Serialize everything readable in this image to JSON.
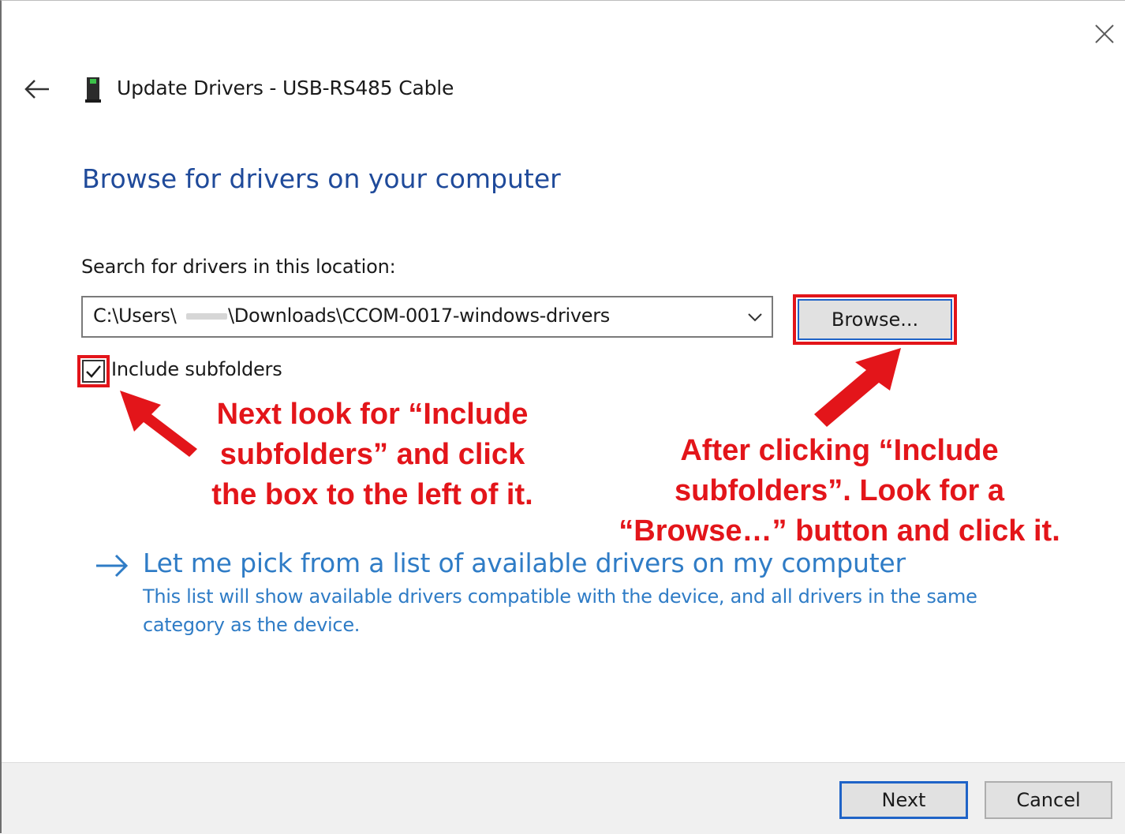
{
  "window": {
    "title": "Update Drivers - USB-RS485 Cable",
    "icons": {
      "close": "close-icon",
      "back": "back-arrow-icon",
      "device": "usb-device-icon"
    }
  },
  "page": {
    "heading": "Browse for drivers on your computer",
    "search_label": "Search for drivers in this location:",
    "path_value_start": "C:\\Users\\",
    "path_value_end": "\\Downloads\\CCOM-0017-windows-drivers",
    "browse_label": "Browse...",
    "include_subfolders_label": "Include subfolders",
    "include_subfolders_checked": true
  },
  "annotations": {
    "left": [
      "Next look for “Include",
      "subfolders” and click",
      "the box to the left of it."
    ],
    "right": [
      "After clicking “Include",
      "subfolders”. Look for a",
      "“Browse…” button and click it."
    ],
    "highlight_color": "#e3151a"
  },
  "pick_option": {
    "title": "Let me pick from a list of available drivers on my computer",
    "description": "This list will show available drivers compatible with the device, and all drivers in the same category as the device.",
    "icon": "right-arrow-icon"
  },
  "footer": {
    "next_label": "Next",
    "cancel_label": "Cancel"
  },
  "colors": {
    "heading": "#1f4a9a",
    "link": "#2f7cc6",
    "focus_border": "#1f63c7",
    "footer_bg": "#f0f0f0"
  }
}
